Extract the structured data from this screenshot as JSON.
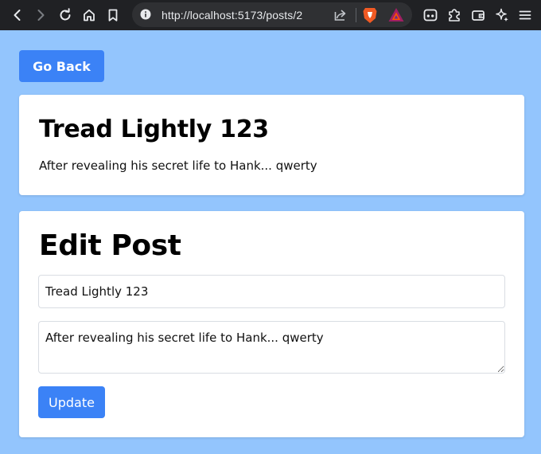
{
  "browser": {
    "url": "http://localhost:5173/posts/2",
    "icons": [
      "back-arrow-icon",
      "forward-arrow-icon",
      "reload-icon",
      "home-icon",
      "bookmark-icon",
      "info-icon",
      "share-icon",
      "brave-shield-icon",
      "bat-rewards-icon",
      "leo-icon",
      "extensions-icon",
      "wallet-icon",
      "ai-sparkle-icon",
      "menu-icon"
    ]
  },
  "page": {
    "back_label": "Go Back",
    "post": {
      "title": "Tread Lightly 123",
      "body": "After revealing his secret life to Hank... qwerty"
    },
    "edit": {
      "heading": "Edit Post",
      "title_value": "Tread Lightly 123",
      "body_value": "After revealing his secret life to Hank... qwerty",
      "update_label": "Update"
    }
  },
  "colors": {
    "page_background": "#93c5fd",
    "button": "#3b82f6",
    "toolbar": "#202124"
  }
}
